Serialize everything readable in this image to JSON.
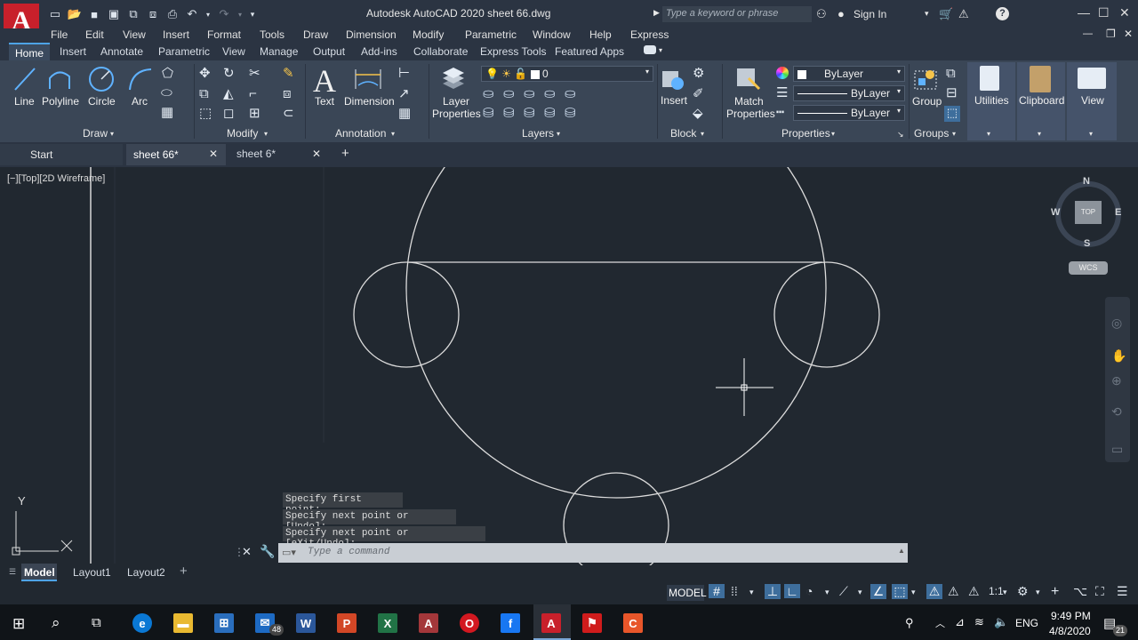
{
  "app": {
    "title": "Autodesk AutoCAD 2020   sheet 66.dwg",
    "logo_letter": "A",
    "search_placeholder": "Type a keyword or phrase",
    "sign_in": "Sign In"
  },
  "menu": [
    "File",
    "Edit",
    "View",
    "Insert",
    "Format",
    "Tools",
    "Draw",
    "Dimension",
    "Modify",
    "Parametric",
    "Window",
    "Help",
    "Express"
  ],
  "ribbon_tabs": [
    "Home",
    "Insert",
    "Annotate",
    "Parametric",
    "View",
    "Manage",
    "Output",
    "Add-ins",
    "Collaborate",
    "Express Tools",
    "Featured Apps"
  ],
  "ribbon": {
    "draw": {
      "line": "Line",
      "polyline": "Polyline",
      "circle": "Circle",
      "arc": "Arc",
      "panel": "Draw"
    },
    "modify": {
      "panel": "Modify"
    },
    "annotation": {
      "text": "Text",
      "dimension": "Dimension",
      "panel": "Annotation"
    },
    "layers": {
      "layer_properties_1": "Layer",
      "layer_properties_2": "Properties",
      "current_layer": "0",
      "panel": "Layers"
    },
    "block": {
      "insert": "Insert",
      "panel": "Block"
    },
    "properties": {
      "match_1": "Match",
      "match_2": "Properties",
      "color": "ByLayer",
      "linetype": "ByLayer",
      "lineweight": "ByLayer",
      "panel": "Properties"
    },
    "groups": {
      "group": "Group",
      "panel": "Groups"
    },
    "utilities": "Utilities",
    "clipboard": "Clipboard",
    "view": "View"
  },
  "doc_tabs": {
    "start": "Start",
    "active": "sheet 66*",
    "other": "sheet 6*"
  },
  "viewport_label": "[−][Top][2D Wireframe]",
  "viewcube": {
    "n": "N",
    "s": "S",
    "e": "E",
    "w": "W",
    "top": "TOP",
    "wcs": "WCS"
  },
  "ucs": {
    "y": "Y",
    "x": "X"
  },
  "command": {
    "history": [
      "Specify first point:",
      "Specify next point or [Undo]:",
      "Specify next point or [eXit/Undo]:"
    ],
    "placeholder": "Type a command"
  },
  "layout_tabs": [
    "Model",
    "Layout1",
    "Layout2"
  ],
  "status": {
    "model": "MODEL",
    "scale": "1:1"
  },
  "taskbar": {
    "time": "9:49 PM",
    "date": "4/8/2020",
    "lang": "ENG",
    "mail_badge": "48",
    "notif_badge": "21"
  },
  "colors": {
    "accent": "#4ea3e6",
    "autocad_red": "#c8202b",
    "canvas": "#212830"
  }
}
